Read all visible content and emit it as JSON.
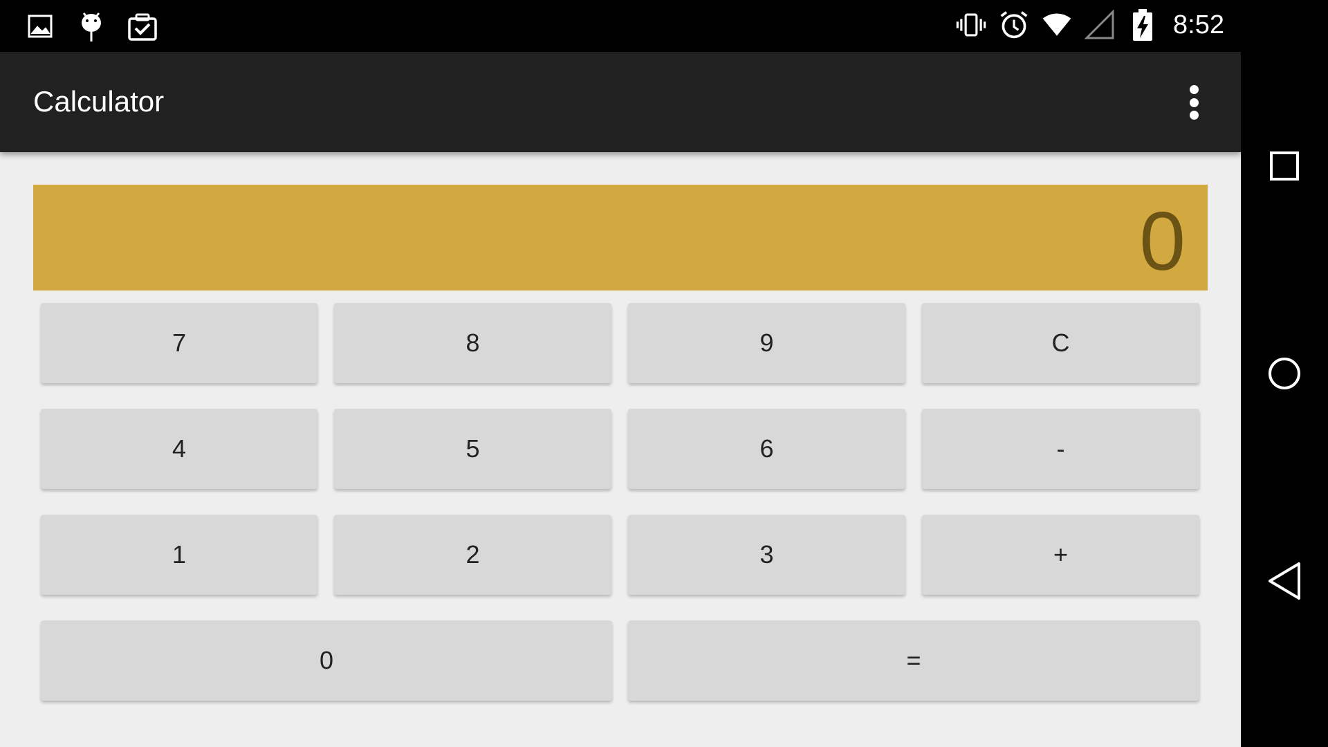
{
  "status_bar": {
    "time": "8:52",
    "left_icons": [
      "gallery-icon",
      "android-debug-icon",
      "clipboard-check-icon"
    ],
    "right_icons": [
      "vibrate-icon",
      "alarm-icon",
      "wifi-icon",
      "cell-signal-icon",
      "battery-charging-icon"
    ]
  },
  "app_bar": {
    "title": "Calculator"
  },
  "display": {
    "value": "0",
    "background": "#d2a841",
    "text_color": "#6b5316"
  },
  "keypad": {
    "row1": [
      "7",
      "8",
      "9",
      "C"
    ],
    "row2": [
      "4",
      "5",
      "6",
      "-"
    ],
    "row3": [
      "1",
      "2",
      "3",
      "+"
    ],
    "row4": [
      "0",
      "="
    ]
  },
  "nav_bar": {
    "buttons": [
      "recent-apps-icon",
      "home-icon",
      "back-icon"
    ]
  }
}
